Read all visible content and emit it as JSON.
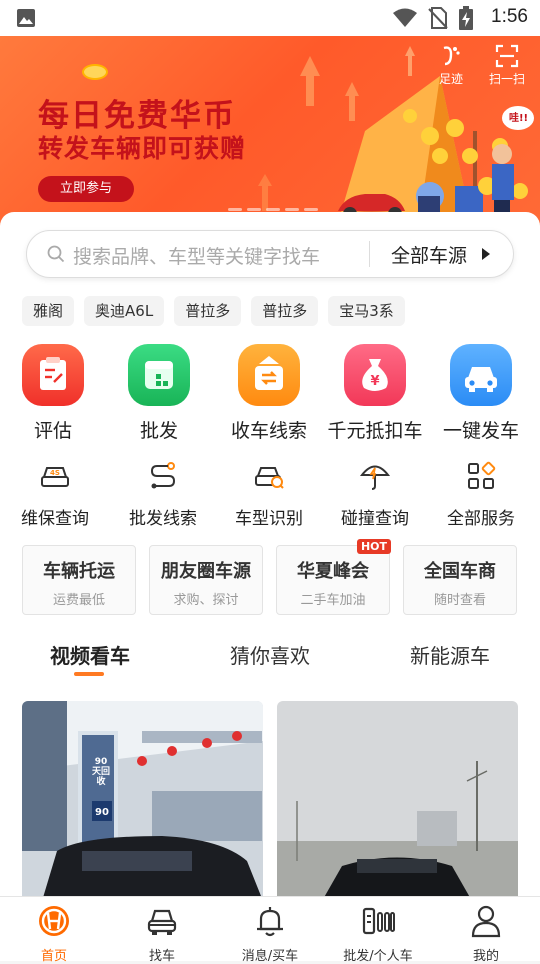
{
  "status": {
    "time": "1:56"
  },
  "banner": {
    "title": "每日免费华币",
    "subtitle": "转发车辆即可获赠",
    "cta": "立即参与",
    "footprint_label": "足迹",
    "scan_label": "扫一扫",
    "bubble_text": "哇!!"
  },
  "search": {
    "placeholder": "搜索品牌、车型等关键字找车",
    "source_label": "全部车源"
  },
  "chips": [
    "雅阁",
    "奥迪A6L",
    "普拉多",
    "普拉多",
    "宝马3系"
  ],
  "main_icons": [
    {
      "label": "评估",
      "color": "#f4473a"
    },
    {
      "label": "批发",
      "color": "#27c46b"
    },
    {
      "label": "收车线索",
      "color": "#ff9a1f"
    },
    {
      "label": "千元抵扣车",
      "color": "#ff4a6a"
    },
    {
      "label": "一键发车",
      "color": "#3a9dff"
    }
  ],
  "services": [
    {
      "label": "维保查询",
      "icon": "car-4s-icon"
    },
    {
      "label": "批发线索",
      "icon": "route-icon"
    },
    {
      "label": "车型识别",
      "icon": "car-scan-icon"
    },
    {
      "label": "碰撞查询",
      "icon": "umbrella-icon"
    },
    {
      "label": "全部服务",
      "icon": "grid-icon"
    }
  ],
  "feature_boxes": [
    {
      "title": "车辆托运",
      "sub": "运费最低"
    },
    {
      "title": "朋友圈车源",
      "sub": "求购、探讨"
    },
    {
      "title": "华夏峰会",
      "sub": "二手车加油",
      "badge": "HOT"
    },
    {
      "title": "全国车商",
      "sub": "随时查看"
    }
  ],
  "tabs": [
    "视频看车",
    "猜你喜欢",
    "新能源车"
  ],
  "video_card": {
    "sign_text": "90天回收"
  },
  "bottom_nav": [
    {
      "label": "首页"
    },
    {
      "label": "找车"
    },
    {
      "label": "消息/买车"
    },
    {
      "label": "批发/个人车"
    },
    {
      "label": "我的"
    }
  ],
  "colors": {
    "accent": "#ff6a00",
    "brand_red": "#c4121b",
    "banner_bg": "#ff5a2a"
  }
}
